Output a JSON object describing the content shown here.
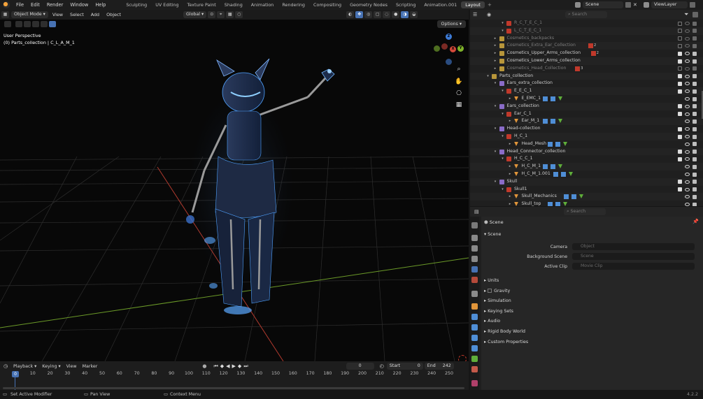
{
  "topbar": {
    "menus": [
      "File",
      "Edit",
      "Render",
      "Window",
      "Help"
    ],
    "workspaces": [
      "Sculpting",
      "UV Editing",
      "Texture Paint",
      "Shading",
      "Animation",
      "Rendering",
      "Compositing",
      "Geometry Nodes",
      "Scripting",
      "Animation.001",
      "Layout"
    ],
    "active_workspace": "Layout",
    "add_workspace": "+",
    "scene": "Scene",
    "view_layer": "ViewLayer"
  },
  "viewport": {
    "mode": "Object Mode",
    "menus": [
      "View",
      "Select",
      "Add",
      "Object"
    ],
    "transform_orientation": "Global",
    "options": "Options",
    "perspective_label": "User Perspective",
    "active_object_label": "(0) Parts_collection | C_L_A_M_1",
    "gizmo": {
      "z": "Z",
      "y": "Y",
      "x": "X"
    }
  },
  "outliner": {
    "search_placeholder": "Search",
    "rows": [
      {
        "label": "R_C_T_E_C_1",
        "indent": 4,
        "type": "collection",
        "muted": true
      },
      {
        "label": "L_C_T_E_C_1",
        "indent": 4,
        "type": "collection",
        "muted": true
      },
      {
        "label": "Cosmetics_backpacks",
        "indent": 3,
        "type": "collection-yellow",
        "muted": true
      },
      {
        "label": "Cosmetics_Extra_Ear_Collection",
        "indent": 3,
        "type": "collection-yellow",
        "muted": true,
        "badge": "2"
      },
      {
        "label": "Cosmetics_Upper_Arms_collection",
        "indent": 3,
        "type": "collection-yellow",
        "muted": false,
        "badge": "2"
      },
      {
        "label": "Cosmetics_Lower_Arms_collection",
        "indent": 3,
        "type": "collection-yellow",
        "muted": false
      },
      {
        "label": "Cosmetics_Head_Collection",
        "indent": 3,
        "type": "collection-yellow",
        "muted": true,
        "badge": "3"
      },
      {
        "label": "Parts_collection",
        "indent": 2,
        "type": "collection-yellow",
        "muted": false
      },
      {
        "label": "Ears_extra_collection",
        "indent": 3,
        "type": "collection-purple",
        "muted": false
      },
      {
        "label": "E_E_C_1",
        "indent": 4,
        "type": "collection",
        "muted": false
      },
      {
        "label": "E_EMC_1",
        "indent": 5,
        "type": "mesh",
        "muted": false
      },
      {
        "label": "Ears_collection",
        "indent": 3,
        "type": "collection-purple",
        "muted": false
      },
      {
        "label": "Ear_C_1",
        "indent": 4,
        "type": "collection",
        "muted": false
      },
      {
        "label": "Ear_M_1",
        "indent": 5,
        "type": "mesh",
        "muted": false
      },
      {
        "label": "Head-collection",
        "indent": 3,
        "type": "collection-purple",
        "muted": false
      },
      {
        "label": "H_C_1",
        "indent": 4,
        "type": "collection",
        "muted": false
      },
      {
        "label": "Head_Mesh",
        "indent": 5,
        "type": "mesh",
        "muted": false
      },
      {
        "label": "Head_Connector_collection",
        "indent": 3,
        "type": "collection-purple",
        "muted": false
      },
      {
        "label": "H_C_C_1",
        "indent": 4,
        "type": "collection",
        "muted": false
      },
      {
        "label": "H_C_M_1",
        "indent": 5,
        "type": "mesh",
        "muted": false
      },
      {
        "label": "H_C_M_1.001",
        "indent": 5,
        "type": "mesh",
        "muted": false
      },
      {
        "label": "Skull",
        "indent": 3,
        "type": "collection-purple",
        "muted": false
      },
      {
        "label": "Skull1",
        "indent": 4,
        "type": "collection",
        "muted": false
      },
      {
        "label": "Skull_Mechanics",
        "indent": 5,
        "type": "mesh",
        "muted": false
      },
      {
        "label": "Skull_top",
        "indent": 5,
        "type": "mesh",
        "muted": false
      }
    ]
  },
  "properties": {
    "search_placeholder": "Search",
    "context": "Scene",
    "panel_title": "Scene",
    "fields": [
      {
        "label": "Camera",
        "placeholder": "Object"
      },
      {
        "label": "Background Scene",
        "placeholder": "Scene"
      },
      {
        "label": "Active Clip",
        "placeholder": "Movie Clip"
      }
    ],
    "sections": [
      "Units",
      "Gravity",
      "Simulation",
      "Keying Sets",
      "Audio",
      "Rigid Body World",
      "Custom Properties"
    ]
  },
  "timeline": {
    "menus": [
      "Playback",
      "Keying",
      "View",
      "Marker"
    ],
    "current_frame": "0",
    "start_label": "Start",
    "start": "0",
    "end_label": "End",
    "end": "242",
    "ticks": [
      "0",
      "10",
      "20",
      "30",
      "40",
      "50",
      "60",
      "70",
      "80",
      "90",
      "100",
      "110",
      "120",
      "130",
      "140",
      "150",
      "160",
      "170",
      "180",
      "190",
      "200",
      "210",
      "220",
      "230",
      "240",
      "250"
    ]
  },
  "statusbar": {
    "left": "Set Active Modifier",
    "middle": "Pan View",
    "right": "Context Menu",
    "version": "4.2.2"
  },
  "colors": {
    "accent": "#4772b3",
    "axis_red": "#c0392b",
    "axis_green": "#7fb32a",
    "collection_yellow": "#b8963a",
    "collection_purple": "#8a6cc8",
    "collection_red": "#c0392b",
    "mesh_orange": "#e0953a"
  }
}
